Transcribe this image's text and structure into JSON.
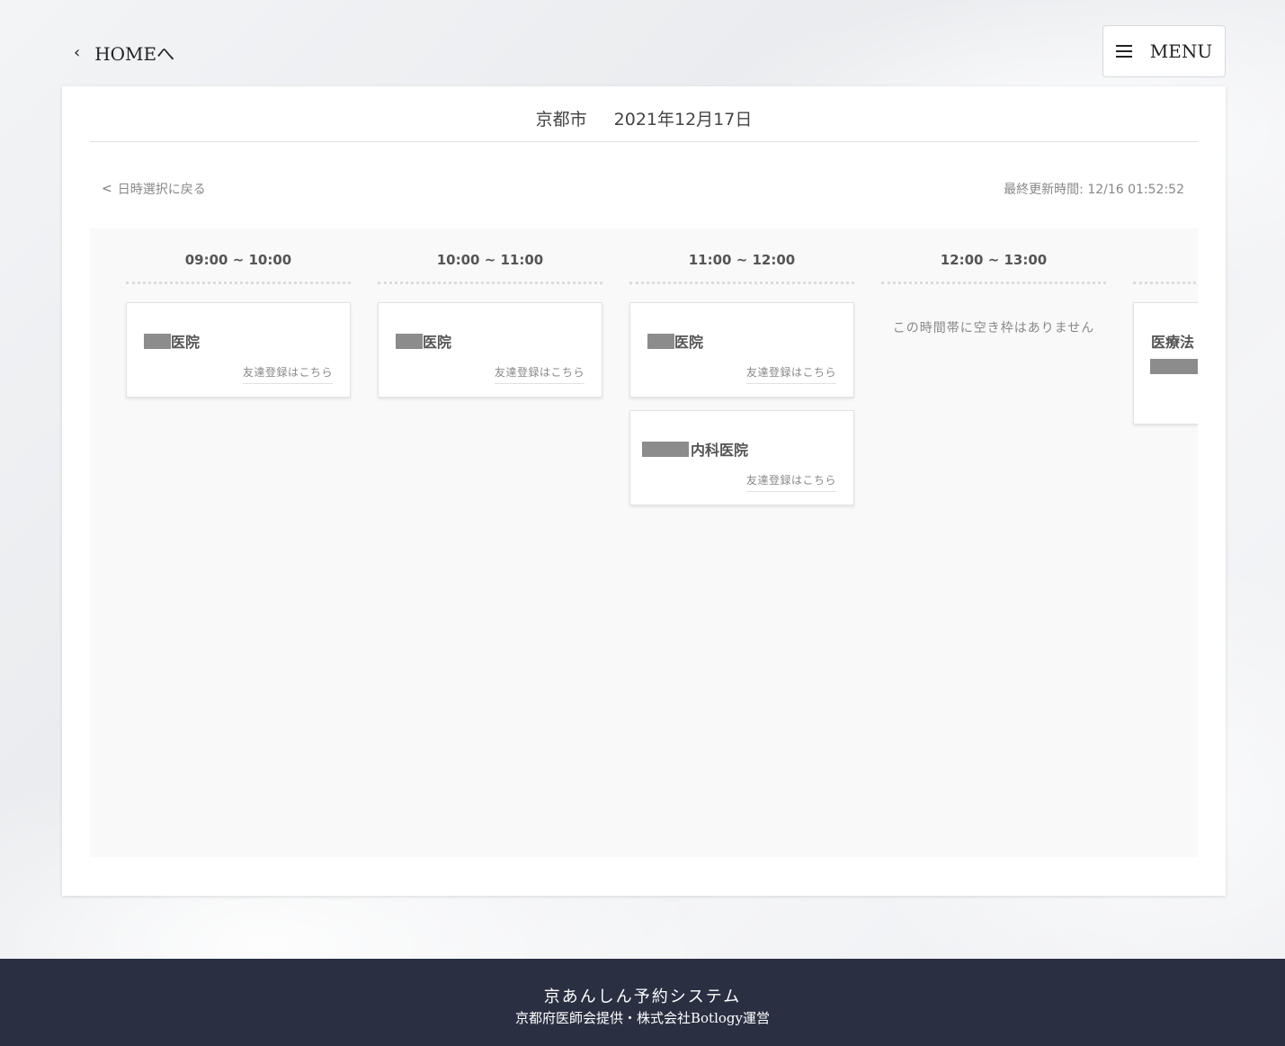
{
  "header": {
    "home_label": "HOMEへ",
    "menu_label": "MENU"
  },
  "page": {
    "city": "京都市",
    "date": "2021年12月17日",
    "back_label": "日時選択に戻る",
    "last_updated": "最終更新時間: 12/16 01:52:52"
  },
  "slots": [
    {
      "time": "09:00 ~ 10:00",
      "clinics": [
        {
          "name_suffix": "医院",
          "friend_link": "友達登録はこちら"
        }
      ]
    },
    {
      "time": "10:00 ~ 11:00",
      "clinics": [
        {
          "name_suffix": "医院",
          "friend_link": "友達登録はこちら"
        }
      ]
    },
    {
      "time": "11:00 ~ 12:00",
      "clinics": [
        {
          "name_suffix": "医院",
          "friend_link": "友達登録はこちら"
        },
        {
          "name_suffix": "内科医院",
          "friend_link": "友達登録はこちら"
        }
      ]
    },
    {
      "time": "12:00 ~ 13:00",
      "empty_message": "この時間帯に空き枠はありません"
    },
    {
      "time": "",
      "clinics": [
        {
          "name_suffix": "医療法"
        }
      ]
    }
  ],
  "footer": {
    "title": "京あんしん予約システム",
    "subtitle": "京都府医師会提供・株式会社Botlogy運営"
  },
  "colors": {
    "footer_bg": "#2a2f42",
    "redaction": "#8c8c8c"
  }
}
